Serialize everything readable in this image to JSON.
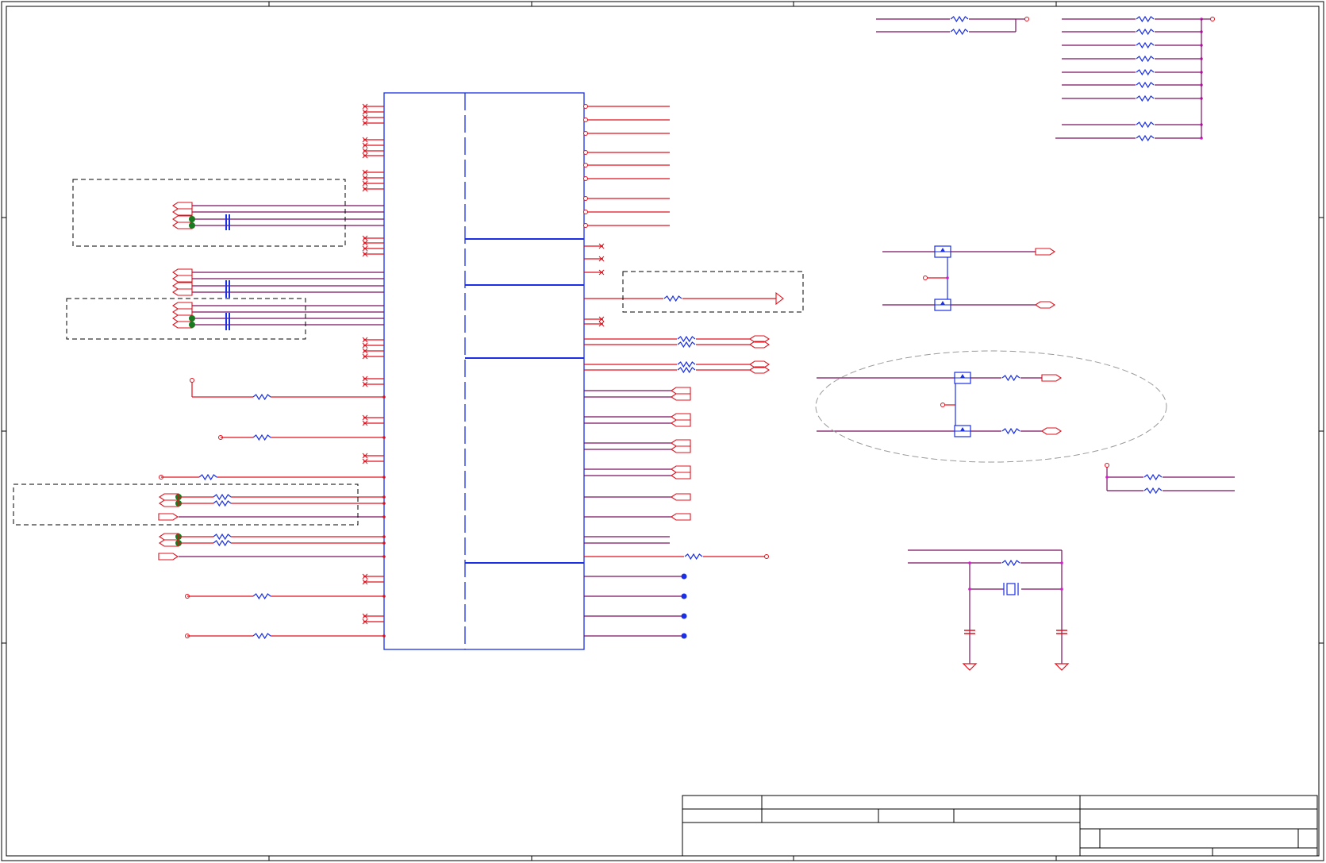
{
  "document": {
    "type": "schematic",
    "title_block": {
      "title": "",
      "fields": []
    }
  },
  "colors": {
    "wire": "#e0101c",
    "net": "#7a1060",
    "component": "#1a2fe6",
    "junction": "#1a7a20",
    "frame": "#000000",
    "dashed": "#000000",
    "ellipse": "#9a9a9a",
    "pin_dot": "#d51dcf"
  },
  "icons": [
    "resistor-icon",
    "capacitor-icon",
    "mosfet-icon",
    "crystal-icon",
    "ground-icon",
    "connector-icon",
    "no-connect-icon"
  ]
}
